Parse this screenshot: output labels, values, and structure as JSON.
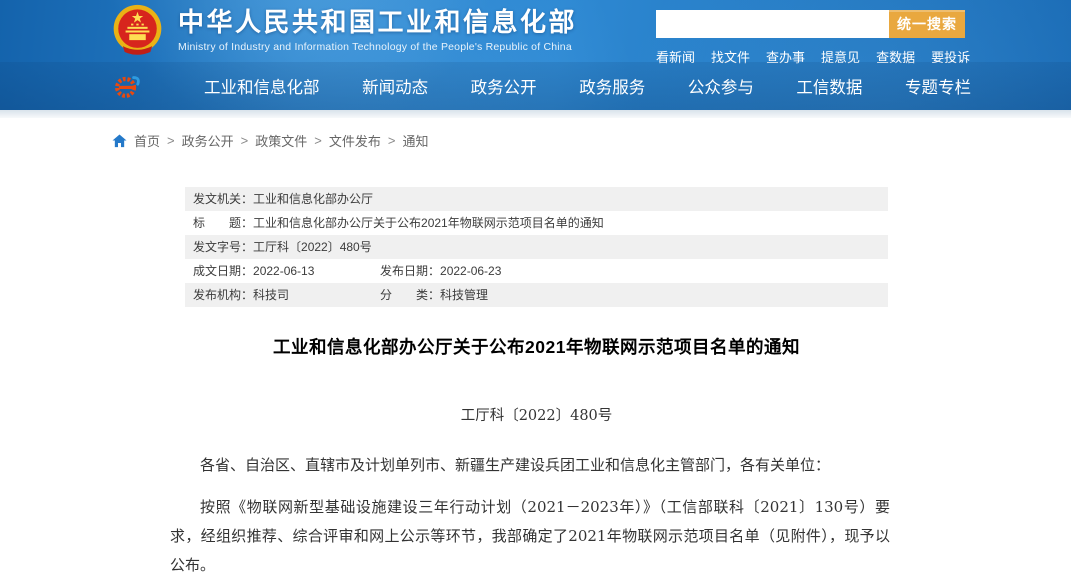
{
  "header": {
    "site_title": "中华人民共和国工业和信息化部",
    "site_subtitle": "Ministry of Industry and Information Technology of the People's Republic of China",
    "search": {
      "value": "",
      "button_label": "统一搜索"
    },
    "quick_links": [
      "看新闻",
      "找文件",
      "查办事",
      "提意见",
      "查数据",
      "要投诉"
    ]
  },
  "nav": {
    "items": [
      "工业和信息化部",
      "新闻动态",
      "政务公开",
      "政务服务",
      "公众参与",
      "工信数据",
      "专题专栏"
    ]
  },
  "breadcrumb": {
    "separator": ">",
    "items": [
      "首页",
      "政务公开",
      "政策文件",
      "文件发布",
      "通知"
    ]
  },
  "meta_table": {
    "issuing_office": {
      "label": "发文机关：",
      "value": "工业和信息化部办公厅"
    },
    "title": {
      "label": "标　　题：",
      "value": "工业和信息化部办公厅关于公布2021年物联网示范项目名单的通知"
    },
    "doc_number": {
      "label": "发文字号：",
      "value": "工厅科〔2022〕480号"
    },
    "written_date": {
      "label": "成文日期：",
      "value": "2022-06-13"
    },
    "publish_date": {
      "label": "发布日期：",
      "value": "2022-06-23"
    },
    "publish_org": {
      "label": "发布机构：",
      "value": "科技司"
    },
    "category": {
      "label": "分　　类：",
      "value": "科技管理"
    }
  },
  "document": {
    "title": "工业和信息化部办公厅关于公布2021年物联网示范项目名单的通知",
    "doc_number": "工厅科〔2022〕480号",
    "salutation": "各省、自治区、直辖市及计划单列市、新疆生产建设兵团工业和信息化主管部门，各有关单位：",
    "paragraph": "按照《物联网新型基础设施建设三年行动计划（2021－2023年）》（工信部联科〔2021〕130号）要求，经组织推荐、综合评审和网上公示等环节，我部确定了2021年物联网示范项目名单（见附件），现予以公布。"
  },
  "colors": {
    "banner_blue": "#2176c7",
    "accent_orange": "#e9a83f",
    "emblem_red": "#d7251d",
    "emblem_gold": "#eab215",
    "link_blue": "#2479c9"
  }
}
